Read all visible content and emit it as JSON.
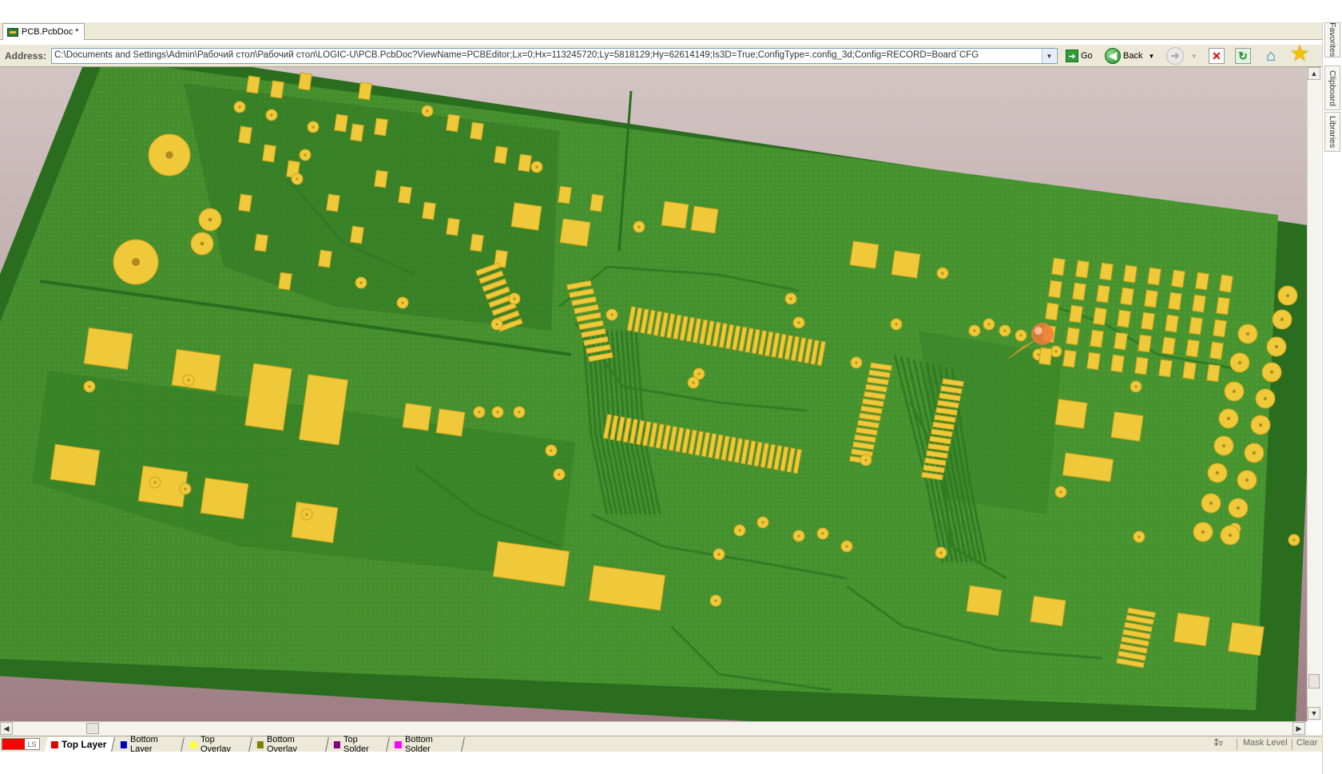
{
  "document_tab": {
    "label": "PCB.PcbDoc *"
  },
  "address": {
    "label": "Address:",
    "value": "C:\\Documents and Settings\\Admin\\Рабочий стол\\Рабочий стол\\LOGIC-U\\PCB.PcbDoc?ViewName=PCBEditor;Lx=0;Hx=113245720;Ly=5818129;Hy=62614149;Is3D=True;ConfigType=.config_3d;Config=RECORD=Board`CFG"
  },
  "toolbar": {
    "go_label": "Go",
    "back_label": "Back"
  },
  "side_panels": [
    "Favorites",
    "Clipboard",
    "Libraries"
  ],
  "layer_bar": {
    "ls_label": "LS",
    "layers": [
      {
        "name": "Top Layer",
        "color": "#e00000",
        "active": true
      },
      {
        "name": "Bottom Layer",
        "color": "#0000c0",
        "active": false
      },
      {
        "name": "Top Overlay",
        "color": "#ffff40",
        "active": false
      },
      {
        "name": "Bottom Overlay",
        "color": "#808000",
        "active": false
      },
      {
        "name": "Top Solder",
        "color": "#800080",
        "active": false
      },
      {
        "name": "Bottom Solder",
        "color": "#ff00ff",
        "active": false
      }
    ],
    "mask_level_label": "Mask Level",
    "clear_label": "Clear"
  },
  "colors": {
    "board_green": "#3e8a2c",
    "board_edge": "#2a6a1e",
    "pad_gold": "#f0c93a",
    "viewport_background": "#c4adae"
  }
}
